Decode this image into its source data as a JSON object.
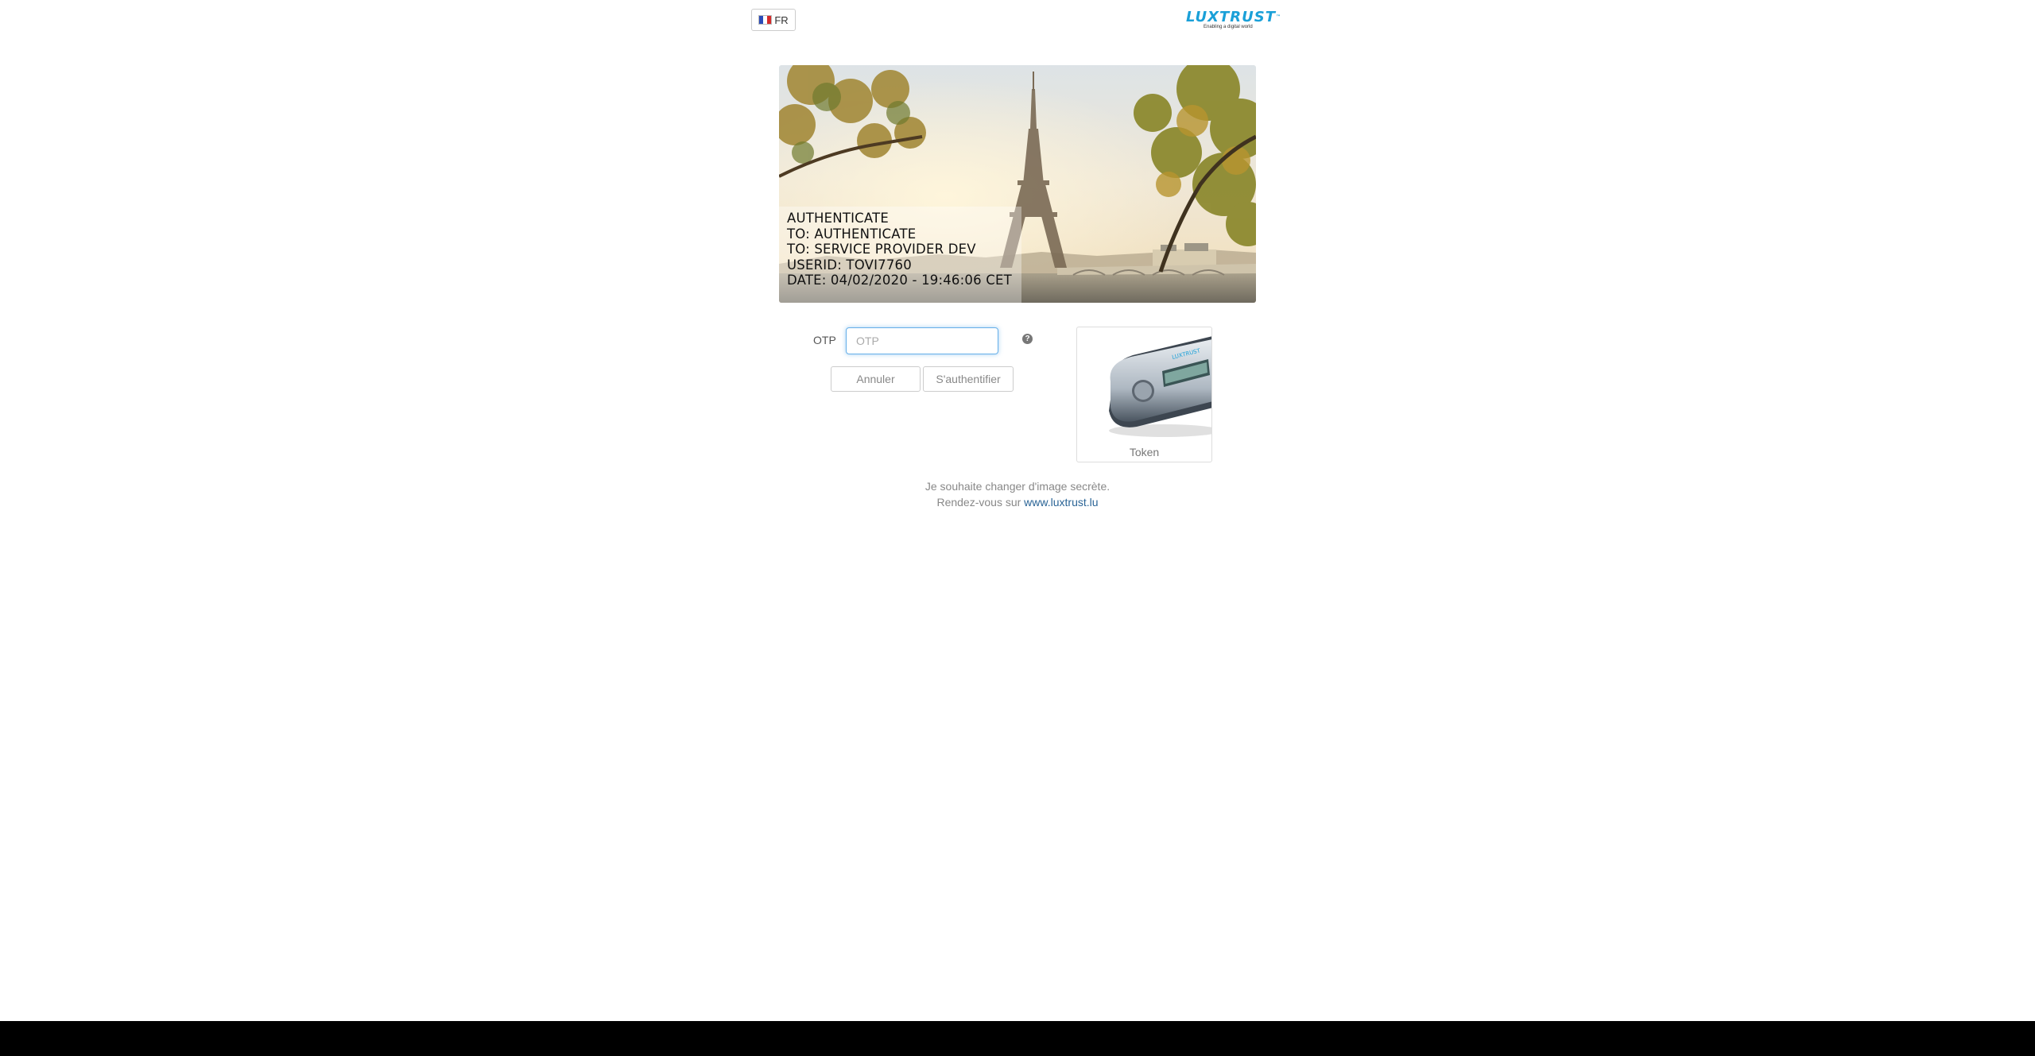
{
  "language": {
    "code": "FR",
    "flag_colors": [
      "#2b4bb8",
      "#ffffff",
      "#d52b2b"
    ]
  },
  "logo": {
    "name": "LUXTRUST",
    "tagline": "Enabling a digital world"
  },
  "secret_image": {
    "lines": [
      "AUTHENTICATE",
      "TO: AUTHENTICATE",
      "TO: SERVICE PROVIDER DEV",
      "USERID: TOVI7760",
      "DATE: 04/02/2020 - 19:46:06 CET"
    ]
  },
  "form": {
    "otp_label": "OTP",
    "otp_placeholder": "OTP",
    "otp_value": "",
    "help_icon": "question-circle-icon",
    "cancel_label": "Annuler",
    "submit_label": "S'authentifier"
  },
  "token": {
    "label": "Token"
  },
  "info": {
    "line1": "Je souhaite changer d'image secrète.",
    "line2_prefix": "Rendez-vous sur ",
    "link_text": "www.luxtrust.lu"
  },
  "colors": {
    "accent": "#1aa0d8",
    "link": "#2a6496",
    "focus": "#66afe9",
    "footer": "#000000"
  }
}
